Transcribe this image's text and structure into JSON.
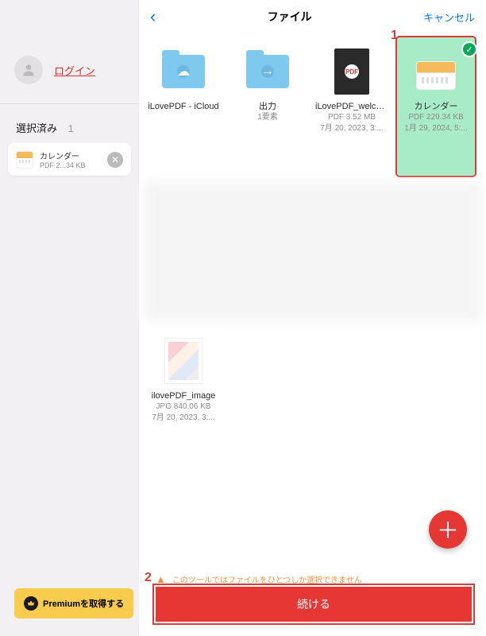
{
  "sidebar": {
    "login_label": "ログイン",
    "selected_label": "選択済み",
    "selected_count": "1",
    "selected_item": {
      "name": "カレンダー",
      "meta": "PDF 2...34 KB"
    },
    "premium_label": "Premiumを取得する"
  },
  "topbar": {
    "back": "‹",
    "title": "ファイル",
    "cancel": "キャンセル"
  },
  "tiles": [
    {
      "name": "iLovePDF - iCloud",
      "meta1": "",
      "meta2": ""
    },
    {
      "name": "出力",
      "meta1": "1要素",
      "meta2": ""
    },
    {
      "name": "iLovePDF_welcome",
      "meta1": "PDF 3.52 MB",
      "meta2": "7月 20, 2023, 3:..."
    },
    {
      "name": "カレンダー",
      "meta1": "PDF 229.34 KB",
      "meta2": "1月 29, 2024, 5:..."
    },
    {
      "name": "ilovePDF_image",
      "meta1": "JPG 840.06 KB",
      "meta2": "7月 20, 2023, 3:..."
    }
  ],
  "warning_text": "このツールではファイルをひとつしか選択できません",
  "continue_label": "続ける",
  "annotations": {
    "marker1": "1",
    "marker2": "2"
  }
}
